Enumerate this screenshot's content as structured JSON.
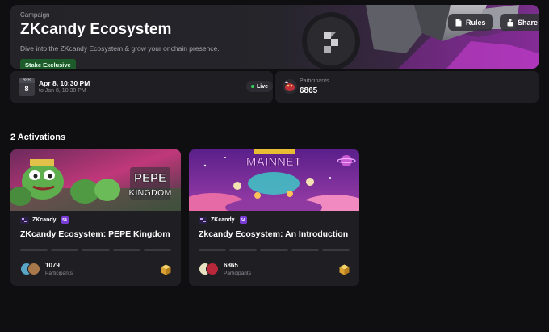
{
  "campaign": {
    "eyebrow": "Campaign",
    "title": "ZKcandy Ecosystem",
    "subtitle": "Dive into the ZKcandy Ecosystem & grow your onchain presence.",
    "badge": "Stake Exclusive",
    "actions": {
      "rules_label": "Rules",
      "share_label": "Share"
    }
  },
  "schedule": {
    "month": "APR",
    "day": "8",
    "start": "Apr 8, 10:30 PM",
    "end": "to Jan 8, 10:30 PM",
    "status": "Live"
  },
  "participants": {
    "label": "Participants",
    "count": "6865"
  },
  "activations": {
    "heading": "2 Activations",
    "items": [
      {
        "brand": "ZKcandy",
        "badge": "54",
        "title": "ZKcandy Ecosystem: PEPE Kingdom",
        "image_text": [
          "PEPE",
          "KINGDOM"
        ],
        "count": "1079",
        "count_label": "Participants",
        "progress_segments": 5
      },
      {
        "brand": "ZKcandy",
        "badge": "54",
        "title": "Zkcandy Ecosystem: An Introduction",
        "image_text": [
          "MAINNET"
        ],
        "count": "6865",
        "count_label": "Participants",
        "progress_segments": 5
      }
    ]
  },
  "colors": {
    "background": "#0f0f11",
    "card": "#1f1f23",
    "live": "#37d35a",
    "stake_badge": "#1d5c2a",
    "accent_purple": "#7a3cd6"
  },
  "icons": {
    "rules": "document-icon",
    "share": "share-icon",
    "reward": "cube-reward-icon",
    "live": "live-dot-icon"
  }
}
